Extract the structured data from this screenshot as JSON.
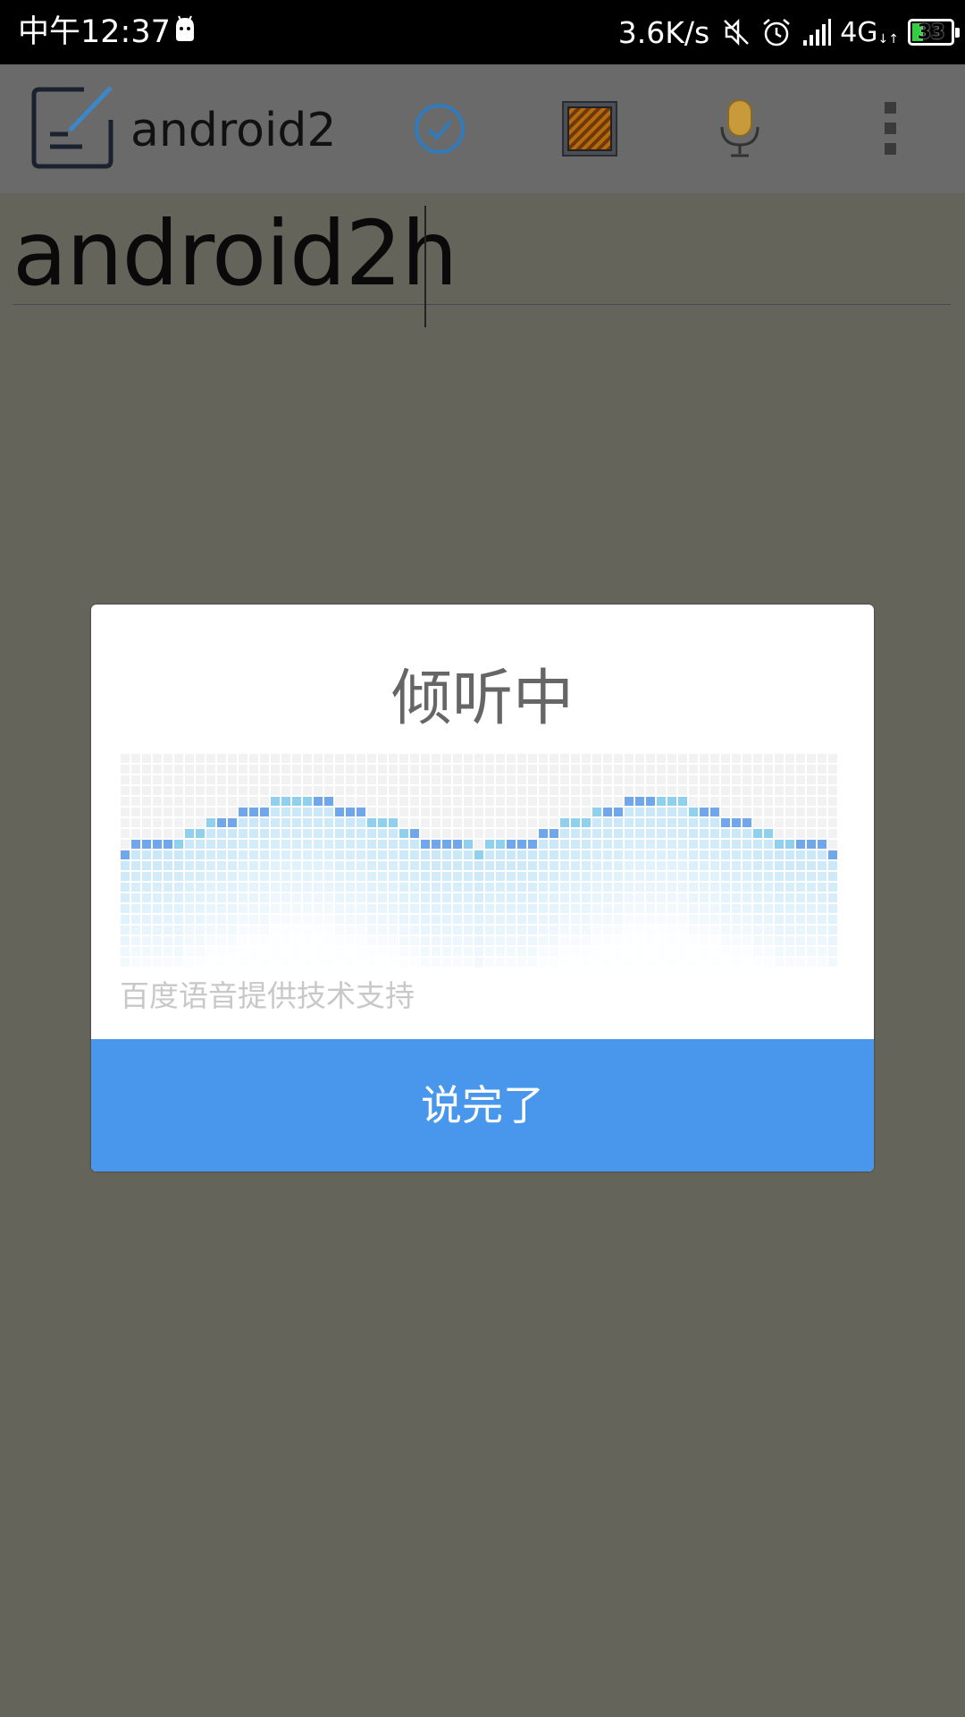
{
  "status_bar": {
    "time": "中午12:37",
    "net_speed": "3.6K/s",
    "network_type": "4G",
    "network_sub": "↓↑",
    "battery_level": "33",
    "icons": [
      "android-notification-icon",
      "mute-icon",
      "alarm-icon",
      "signal-icon",
      "battery-icon"
    ]
  },
  "action_bar": {
    "app_title": "android2",
    "actions": [
      "check-icon",
      "crate-icon",
      "microphone-icon",
      "overflow-menu-icon"
    ]
  },
  "editor": {
    "value": "android2h"
  },
  "dialog": {
    "title": "倾听中",
    "credit": "百度语音提供技术支持",
    "button_label": "说完了"
  },
  "colors": {
    "dim_background": "#64645a",
    "action_bar": "#6a6a6a",
    "primary_button": "#4897ec",
    "wave_dark": "#6fa6ec",
    "wave_light": "#8fd0ee"
  }
}
